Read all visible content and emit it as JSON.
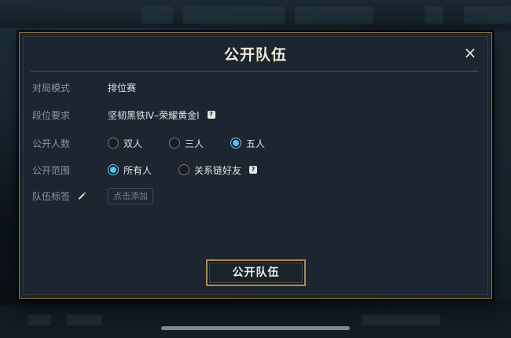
{
  "dialog": {
    "title": "公开队伍",
    "close_icon": "×",
    "mode": {
      "label": "对局模式",
      "value": "排位赛"
    },
    "rank": {
      "label": "段位要求",
      "value": "坚韧黑铁Ⅳ–荣耀黄金Ⅰ",
      "help_icon": "?"
    },
    "size": {
      "label": "公开人数",
      "options": [
        {
          "label": "双人",
          "checked": false
        },
        {
          "label": "三人",
          "checked": false
        },
        {
          "label": "五人",
          "checked": true
        }
      ]
    },
    "scope": {
      "label": "公开范围",
      "options": [
        {
          "label": "所有人",
          "checked": true
        },
        {
          "label": "关系链好友",
          "checked": false
        }
      ],
      "help_icon": "?"
    },
    "tags": {
      "label": "队伍标签",
      "add_button": "点击添加"
    },
    "submit_button": "公开队伍"
  },
  "colors": {
    "accent_gold": "#a88a52",
    "radio_selected": "#55c1ee",
    "panel_bg": "#1c2530"
  }
}
